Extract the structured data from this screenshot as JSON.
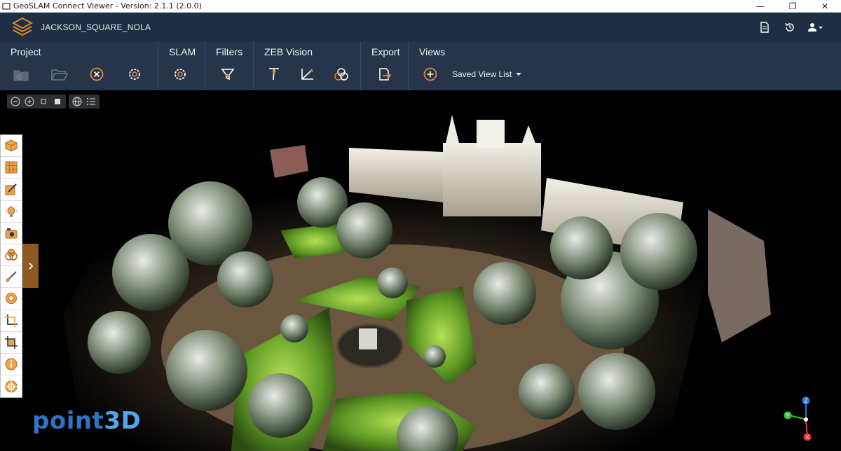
{
  "window": {
    "title": "GeoSLAM Connect Viewer - Version: 2.1.1 (2.0.0)",
    "controls": {
      "minimize": "—",
      "restore": "❐",
      "close": "✕"
    }
  },
  "header": {
    "project_name": "JACKSON_SQUARE_NOLA",
    "icons": [
      "document-icon",
      "history-icon",
      "user-icon"
    ]
  },
  "ribbon": {
    "groups": [
      {
        "title": "Project",
        "buttons": [
          "new-project-icon",
          "open-folder-icon",
          "close-project-icon",
          "settings-gear-icon"
        ]
      },
      {
        "title": "SLAM",
        "buttons": [
          "slam-settings-icon"
        ]
      },
      {
        "title": "Filters",
        "buttons": [
          "filter-funnel-icon"
        ]
      },
      {
        "title": "ZEB Vision",
        "buttons": [
          "vision-pin-icon",
          "measure-axes-icon",
          "colourise-icon"
        ]
      },
      {
        "title": "Export",
        "buttons": [
          "export-icon"
        ]
      },
      {
        "title": "Views",
        "buttons": [
          "add-view-icon"
        ],
        "saved_view_label": "Saved View List"
      }
    ]
  },
  "mini_toolbar": [
    "zoom-out-icon",
    "zoom-in-icon",
    "small-point-icon",
    "large-point-icon",
    "globe-icon",
    "list-icon"
  ],
  "left_tools": [
    "box-view-icon",
    "grid-icon",
    "edit-icon",
    "lightbulb-icon",
    "camera-icon",
    "layers-icon",
    "brush-icon",
    "ring-icon",
    "crop-icon",
    "crop-alt-icon",
    "info-icon",
    "target-icon"
  ],
  "watermark": {
    "main": "point",
    "accent": "3D"
  },
  "gizmo": {
    "z": "Z",
    "y": "Y",
    "x": "X"
  },
  "colors": {
    "header_bg": "#1f2e43",
    "ribbon_bg": "#26354a",
    "accent_orange": "#e08a2c",
    "expand_tab": "#8a5a21"
  }
}
